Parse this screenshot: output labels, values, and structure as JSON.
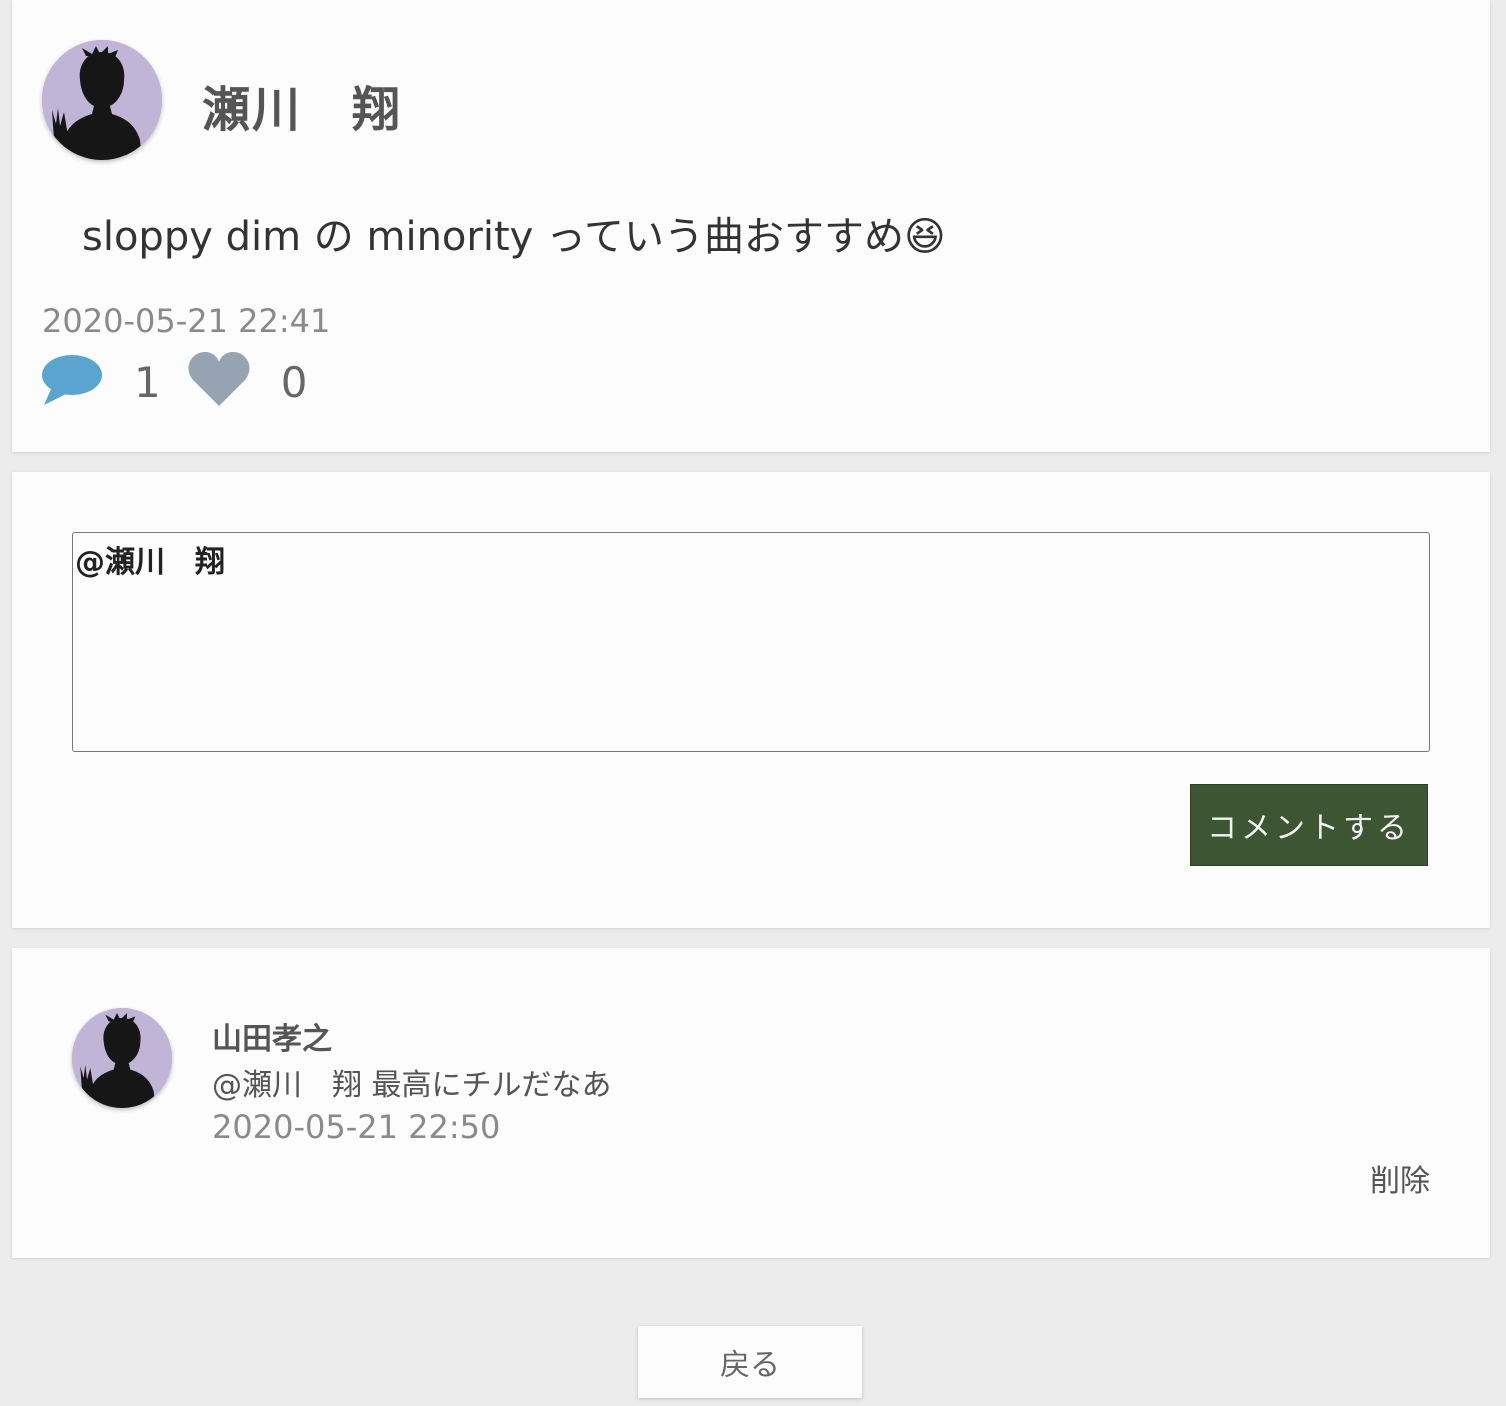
{
  "post": {
    "author": "瀬川　翔",
    "avatar_icon": "user-silhouette-avatar",
    "body": "sloppy dim の minority っていう曲おすすめ😆",
    "timestamp": "2020-05-21 22:41",
    "comment_icon": "speech-bubble-icon",
    "comment_count": "1",
    "like_icon": "heart-icon",
    "like_count": "0"
  },
  "comment_form": {
    "textarea_value": "@瀬川　翔",
    "submit_label": "コメントする"
  },
  "comments": [
    {
      "author": "山田孝之",
      "avatar_icon": "user-silhouette-avatar",
      "text": "@瀬川　翔 最高にチルだなあ",
      "timestamp": "2020-05-21 22:50",
      "delete_label": "削除"
    }
  ],
  "footer": {
    "back_label": "戻る"
  },
  "colors": {
    "page_background": "#ececec",
    "card_background": "#fcfcfc",
    "avatar_background": "#c0b5d6",
    "comment_icon": "#5ba4d0",
    "like_icon": "#95a3b2",
    "submit_button": "#3d5533"
  }
}
